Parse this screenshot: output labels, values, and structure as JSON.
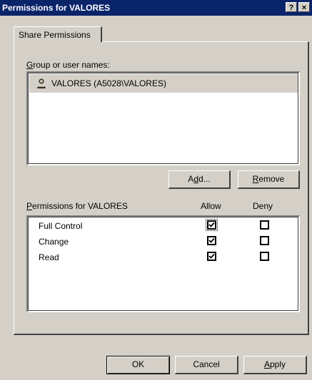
{
  "window": {
    "title": "Permissions for VALORES",
    "help_label": "?",
    "close_label": "×"
  },
  "tabs": [
    {
      "label": "Share Permissions",
      "active": true
    }
  ],
  "group_list": {
    "label": "Group or user names:",
    "items": [
      {
        "name": "VALORES (A5028\\VALORES)",
        "icon": "user-icon",
        "selected": true
      }
    ]
  },
  "buttons": {
    "add": "Add...",
    "remove": "Remove",
    "ok": "OK",
    "cancel": "Cancel",
    "apply": "Apply"
  },
  "permissions": {
    "label": "Permissions for VALORES",
    "allow_header": "Allow",
    "deny_header": "Deny",
    "rows": [
      {
        "name": "Full Control",
        "allow": true,
        "deny": false
      },
      {
        "name": "Change",
        "allow": true,
        "deny": false
      },
      {
        "name": "Read",
        "allow": true,
        "deny": false
      }
    ]
  },
  "colors": {
    "titlebar": "#0a246a",
    "face": "#d4d0c8",
    "selection": "#d4d0c8"
  }
}
